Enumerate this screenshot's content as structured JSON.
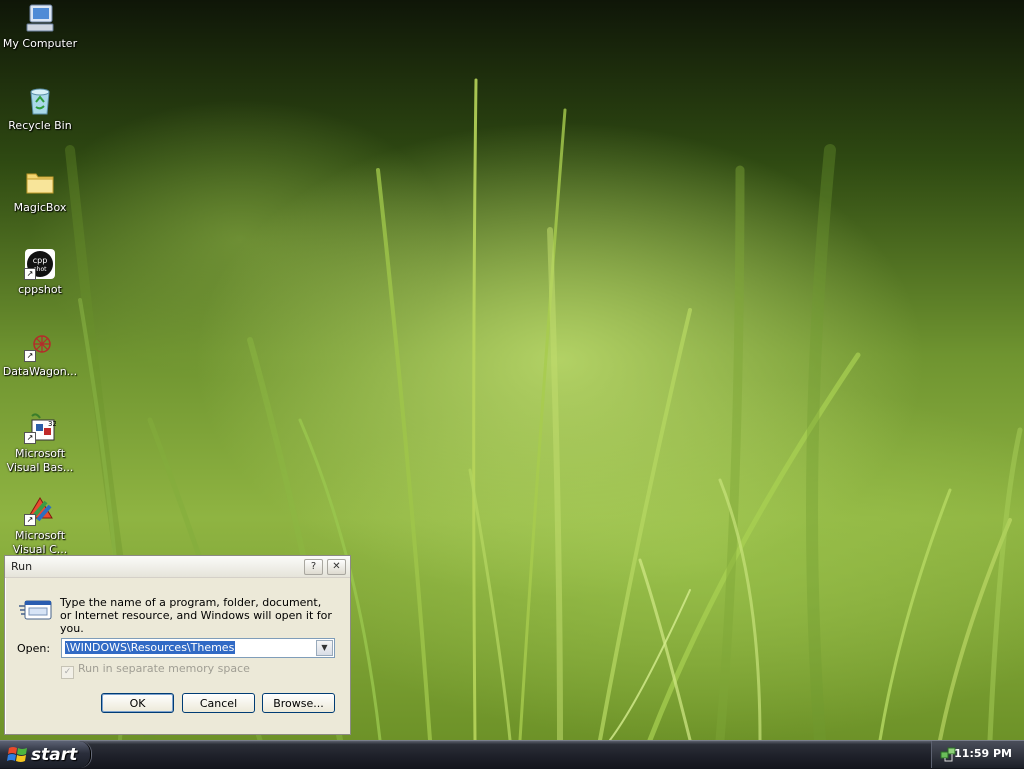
{
  "desktop": {
    "icons": [
      {
        "label": "My Computer",
        "icon": "computer-icon"
      },
      {
        "label": "Recycle Bin",
        "icon": "recycle-bin-icon"
      },
      {
        "label": "MagicBox",
        "icon": "folder-icon"
      },
      {
        "label": "cppshot",
        "icon": "cppshot-icon"
      },
      {
        "label": "DataWagon...",
        "icon": "datawagon-icon"
      },
      {
        "label": "Microsoft\nVisual Bas...",
        "icon": "visual-basic-icon"
      },
      {
        "label": "Microsoft\nVisual C...",
        "icon": "visual-cpp-icon"
      }
    ]
  },
  "run_dialog": {
    "title": "Run",
    "help_label": "?",
    "close_label": "✕",
    "prompt": "Type the name of a program, folder, document, or Internet resource, and Windows will open it for you.",
    "open_label": "Open:",
    "open_value": "\\WINDOWS\\Resources\\Themes",
    "separate_memory_label": "Run in separate memory space",
    "separate_memory_checked": true,
    "ok_label": "OK",
    "cancel_label": "Cancel",
    "browse_label": "Browse..."
  },
  "taskbar": {
    "start_label": "start",
    "clock": "11:59 PM"
  },
  "colors": {
    "selection": "#316ac5",
    "taskbar": "#1e2029",
    "dialog_face": "#ece9d8"
  }
}
